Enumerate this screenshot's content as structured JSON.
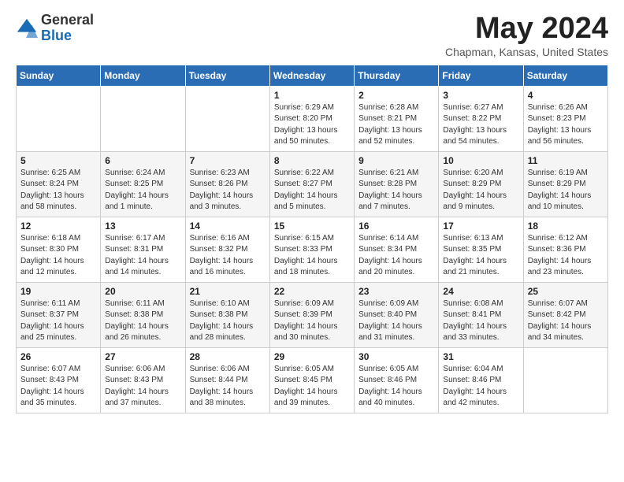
{
  "logo": {
    "general": "General",
    "blue": "Blue"
  },
  "title": "May 2024",
  "location": "Chapman, Kansas, United States",
  "days_of_week": [
    "Sunday",
    "Monday",
    "Tuesday",
    "Wednesday",
    "Thursday",
    "Friday",
    "Saturday"
  ],
  "weeks": [
    [
      {
        "day": "",
        "sunrise": "",
        "sunset": "",
        "daylight": ""
      },
      {
        "day": "",
        "sunrise": "",
        "sunset": "",
        "daylight": ""
      },
      {
        "day": "",
        "sunrise": "",
        "sunset": "",
        "daylight": ""
      },
      {
        "day": "1",
        "sunrise": "Sunrise: 6:29 AM",
        "sunset": "Sunset: 8:20 PM",
        "daylight": "Daylight: 13 hours and 50 minutes."
      },
      {
        "day": "2",
        "sunrise": "Sunrise: 6:28 AM",
        "sunset": "Sunset: 8:21 PM",
        "daylight": "Daylight: 13 hours and 52 minutes."
      },
      {
        "day": "3",
        "sunrise": "Sunrise: 6:27 AM",
        "sunset": "Sunset: 8:22 PM",
        "daylight": "Daylight: 13 hours and 54 minutes."
      },
      {
        "day": "4",
        "sunrise": "Sunrise: 6:26 AM",
        "sunset": "Sunset: 8:23 PM",
        "daylight": "Daylight: 13 hours and 56 minutes."
      }
    ],
    [
      {
        "day": "5",
        "sunrise": "Sunrise: 6:25 AM",
        "sunset": "Sunset: 8:24 PM",
        "daylight": "Daylight: 13 hours and 58 minutes."
      },
      {
        "day": "6",
        "sunrise": "Sunrise: 6:24 AM",
        "sunset": "Sunset: 8:25 PM",
        "daylight": "Daylight: 14 hours and 1 minute."
      },
      {
        "day": "7",
        "sunrise": "Sunrise: 6:23 AM",
        "sunset": "Sunset: 8:26 PM",
        "daylight": "Daylight: 14 hours and 3 minutes."
      },
      {
        "day": "8",
        "sunrise": "Sunrise: 6:22 AM",
        "sunset": "Sunset: 8:27 PM",
        "daylight": "Daylight: 14 hours and 5 minutes."
      },
      {
        "day": "9",
        "sunrise": "Sunrise: 6:21 AM",
        "sunset": "Sunset: 8:28 PM",
        "daylight": "Daylight: 14 hours and 7 minutes."
      },
      {
        "day": "10",
        "sunrise": "Sunrise: 6:20 AM",
        "sunset": "Sunset: 8:29 PM",
        "daylight": "Daylight: 14 hours and 9 minutes."
      },
      {
        "day": "11",
        "sunrise": "Sunrise: 6:19 AM",
        "sunset": "Sunset: 8:29 PM",
        "daylight": "Daylight: 14 hours and 10 minutes."
      }
    ],
    [
      {
        "day": "12",
        "sunrise": "Sunrise: 6:18 AM",
        "sunset": "Sunset: 8:30 PM",
        "daylight": "Daylight: 14 hours and 12 minutes."
      },
      {
        "day": "13",
        "sunrise": "Sunrise: 6:17 AM",
        "sunset": "Sunset: 8:31 PM",
        "daylight": "Daylight: 14 hours and 14 minutes."
      },
      {
        "day": "14",
        "sunrise": "Sunrise: 6:16 AM",
        "sunset": "Sunset: 8:32 PM",
        "daylight": "Daylight: 14 hours and 16 minutes."
      },
      {
        "day": "15",
        "sunrise": "Sunrise: 6:15 AM",
        "sunset": "Sunset: 8:33 PM",
        "daylight": "Daylight: 14 hours and 18 minutes."
      },
      {
        "day": "16",
        "sunrise": "Sunrise: 6:14 AM",
        "sunset": "Sunset: 8:34 PM",
        "daylight": "Daylight: 14 hours and 20 minutes."
      },
      {
        "day": "17",
        "sunrise": "Sunrise: 6:13 AM",
        "sunset": "Sunset: 8:35 PM",
        "daylight": "Daylight: 14 hours and 21 minutes."
      },
      {
        "day": "18",
        "sunrise": "Sunrise: 6:12 AM",
        "sunset": "Sunset: 8:36 PM",
        "daylight": "Daylight: 14 hours and 23 minutes."
      }
    ],
    [
      {
        "day": "19",
        "sunrise": "Sunrise: 6:11 AM",
        "sunset": "Sunset: 8:37 PM",
        "daylight": "Daylight: 14 hours and 25 minutes."
      },
      {
        "day": "20",
        "sunrise": "Sunrise: 6:11 AM",
        "sunset": "Sunset: 8:38 PM",
        "daylight": "Daylight: 14 hours and 26 minutes."
      },
      {
        "day": "21",
        "sunrise": "Sunrise: 6:10 AM",
        "sunset": "Sunset: 8:38 PM",
        "daylight": "Daylight: 14 hours and 28 minutes."
      },
      {
        "day": "22",
        "sunrise": "Sunrise: 6:09 AM",
        "sunset": "Sunset: 8:39 PM",
        "daylight": "Daylight: 14 hours and 30 minutes."
      },
      {
        "day": "23",
        "sunrise": "Sunrise: 6:09 AM",
        "sunset": "Sunset: 8:40 PM",
        "daylight": "Daylight: 14 hours and 31 minutes."
      },
      {
        "day": "24",
        "sunrise": "Sunrise: 6:08 AM",
        "sunset": "Sunset: 8:41 PM",
        "daylight": "Daylight: 14 hours and 33 minutes."
      },
      {
        "day": "25",
        "sunrise": "Sunrise: 6:07 AM",
        "sunset": "Sunset: 8:42 PM",
        "daylight": "Daylight: 14 hours and 34 minutes."
      }
    ],
    [
      {
        "day": "26",
        "sunrise": "Sunrise: 6:07 AM",
        "sunset": "Sunset: 8:43 PM",
        "daylight": "Daylight: 14 hours and 35 minutes."
      },
      {
        "day": "27",
        "sunrise": "Sunrise: 6:06 AM",
        "sunset": "Sunset: 8:43 PM",
        "daylight": "Daylight: 14 hours and 37 minutes."
      },
      {
        "day": "28",
        "sunrise": "Sunrise: 6:06 AM",
        "sunset": "Sunset: 8:44 PM",
        "daylight": "Daylight: 14 hours and 38 minutes."
      },
      {
        "day": "29",
        "sunrise": "Sunrise: 6:05 AM",
        "sunset": "Sunset: 8:45 PM",
        "daylight": "Daylight: 14 hours and 39 minutes."
      },
      {
        "day": "30",
        "sunrise": "Sunrise: 6:05 AM",
        "sunset": "Sunset: 8:46 PM",
        "daylight": "Daylight: 14 hours and 40 minutes."
      },
      {
        "day": "31",
        "sunrise": "Sunrise: 6:04 AM",
        "sunset": "Sunset: 8:46 PM",
        "daylight": "Daylight: 14 hours and 42 minutes."
      },
      {
        "day": "",
        "sunrise": "",
        "sunset": "",
        "daylight": ""
      }
    ]
  ]
}
